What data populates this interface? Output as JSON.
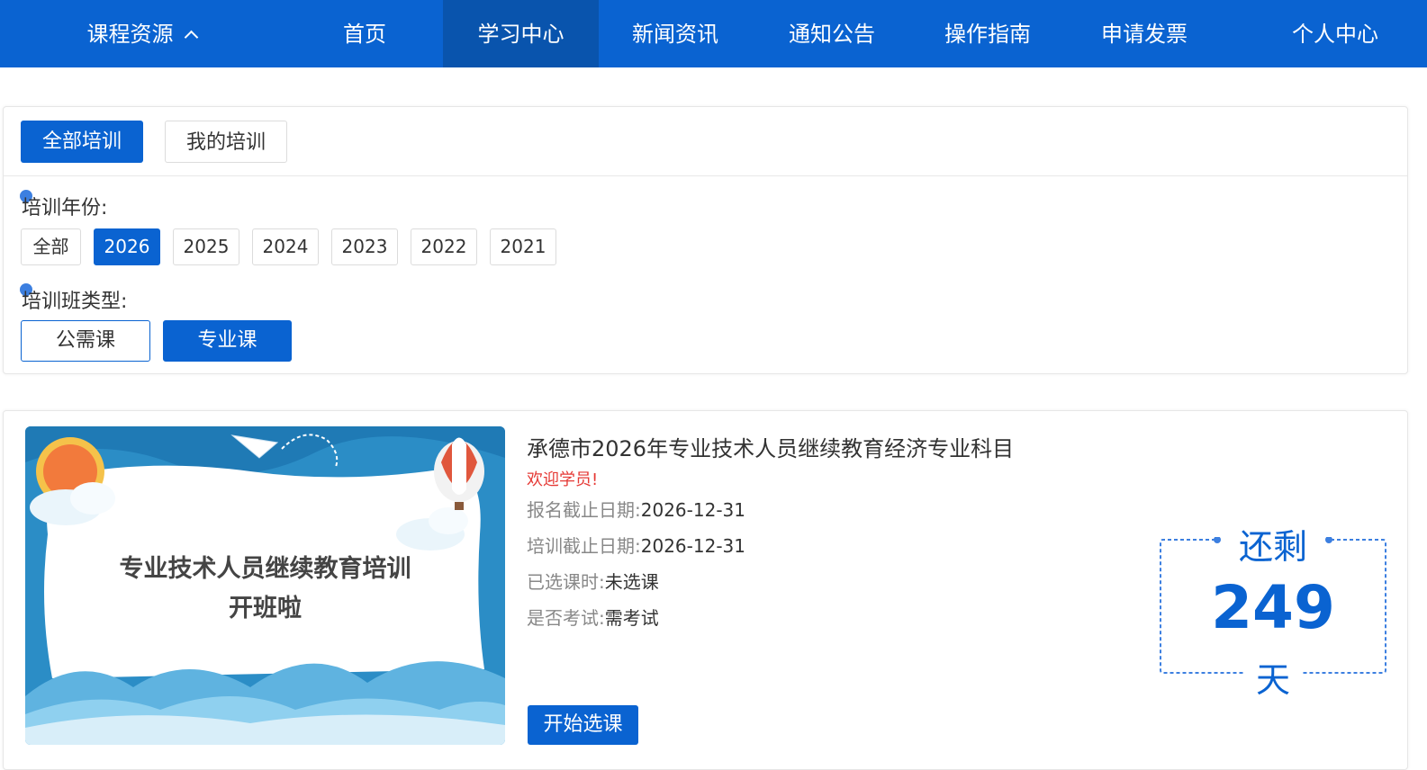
{
  "nav": {
    "course_resources": "课程资源",
    "items": [
      {
        "label": "首页"
      },
      {
        "label": "学习中心"
      },
      {
        "label": "新闻资讯"
      },
      {
        "label": "通知公告"
      },
      {
        "label": "操作指南"
      },
      {
        "label": "申请发票"
      },
      {
        "label": "个人中心"
      }
    ],
    "active": "学习中心"
  },
  "filter": {
    "tabs": [
      {
        "label": "全部培训",
        "selected": true
      },
      {
        "label": "我的培训",
        "selected": false
      }
    ],
    "year_label": "培训年份:",
    "years": [
      {
        "label": "全部",
        "selected": false
      },
      {
        "label": "2026",
        "selected": true
      },
      {
        "label": "2025",
        "selected": false
      },
      {
        "label": "2024",
        "selected": false
      },
      {
        "label": "2023",
        "selected": false
      },
      {
        "label": "2022",
        "selected": false
      },
      {
        "label": "2021",
        "selected": false
      }
    ],
    "type_label": "培训班类型:",
    "types": [
      {
        "label": "公需课",
        "selected": false
      },
      {
        "label": "专业课",
        "selected": true
      }
    ]
  },
  "course": {
    "banner_line1": "专业技术人员继续教育培训",
    "banner_line2": "开班啦",
    "title": "承德市2026年专业技术人员继续教育经济专业科目",
    "welcome": "欢迎学员!",
    "fields": [
      {
        "key": "报名截止日期:",
        "value": "2026-12-31"
      },
      {
        "key": "培训截止日期:",
        "value": "2026-12-31"
      },
      {
        "key": "已选课时:",
        "value": "未选课"
      },
      {
        "key": "是否考试:",
        "value": "需考试"
      }
    ],
    "start_button": "开始选课",
    "countdown": {
      "top": "还剩",
      "days": "249",
      "bottom": "天"
    }
  },
  "colors": {
    "primary": "#0a63d1",
    "active_nav": "#0954ad",
    "welcome": "#e53935"
  }
}
